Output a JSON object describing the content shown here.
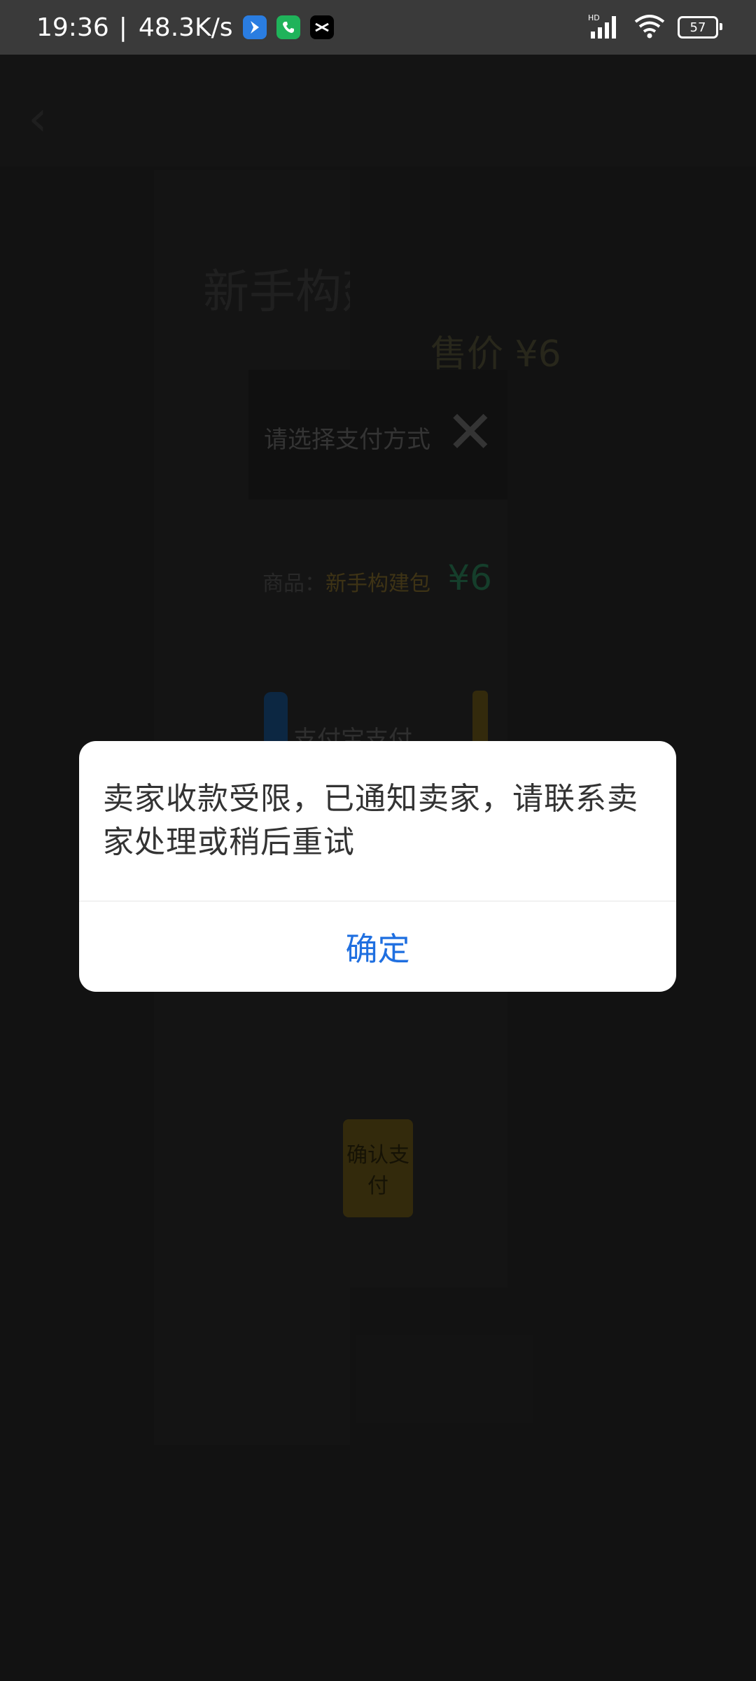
{
  "status_bar": {
    "time": "19:36",
    "separator": "|",
    "net_speed": "48.3K/s",
    "hd_label": "HD",
    "battery": "57",
    "notification_icons": [
      "maps-app-icon",
      "phone-app-icon",
      "capcut-app-icon"
    ]
  },
  "background": {
    "panel_title": "新手构建包",
    "price": "售价 ¥6",
    "dialog_title": "请选择支付方式",
    "item_label": "商品：",
    "item_name": "新手构建包",
    "item_price": "¥6",
    "payment_method": "支付宝支付",
    "confirm_button": "确认支付"
  },
  "alert": {
    "message": "卖家收款受限，已通知卖家，请联系卖家处理或稍后重试",
    "ok_label": "确定"
  },
  "colors": {
    "alert_button": "#1f6fe0",
    "alert_text": "#333333",
    "status_bar_bg": "#3a3a3a"
  }
}
